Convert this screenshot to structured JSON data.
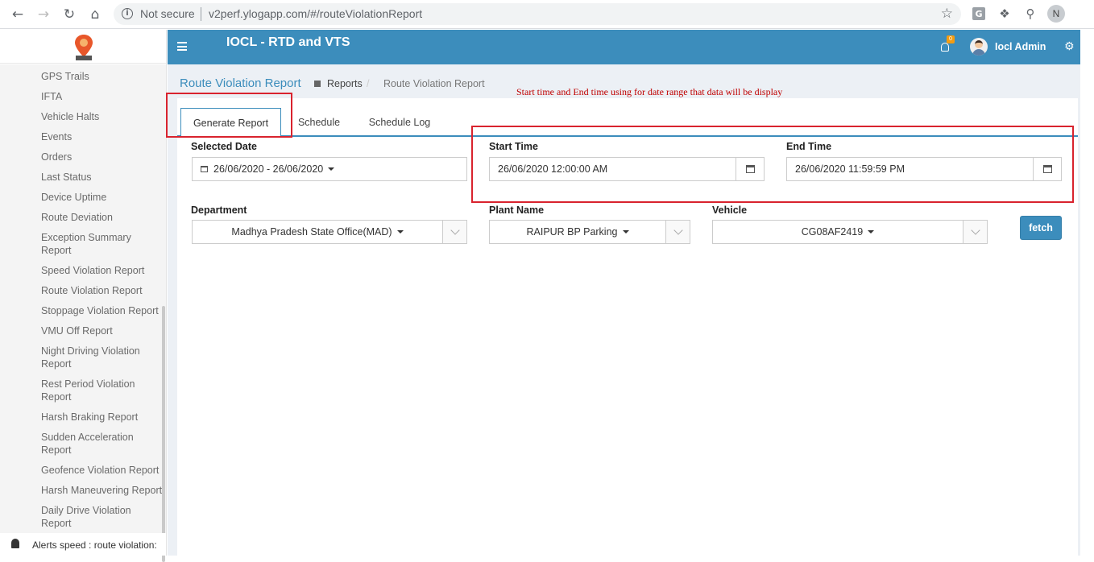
{
  "browser": {
    "security_label": "Not secure",
    "url": "v2perf.ylogapp.com/#/routeViolationReport",
    "profile_initial": "N",
    "extension_g": "G"
  },
  "sidebar": {
    "items": [
      {
        "label": "GPS Trails"
      },
      {
        "label": "IFTA"
      },
      {
        "label": "Vehicle Halts"
      },
      {
        "label": "Events"
      },
      {
        "label": "Orders"
      },
      {
        "label": "Last Status"
      },
      {
        "label": "Device Uptime"
      },
      {
        "label": "Route Deviation"
      },
      {
        "label": "Exception Summary Report"
      },
      {
        "label": "Speed Violation Report"
      },
      {
        "label": "Route Violation Report"
      },
      {
        "label": "Stoppage Violation Report"
      },
      {
        "label": "VMU Off Report"
      },
      {
        "label": "Night Driving Violation Report"
      },
      {
        "label": "Rest Period Violation Report"
      },
      {
        "label": "Harsh Braking Report"
      },
      {
        "label": "Sudden Acceleration Report"
      },
      {
        "label": "Geofence Violation Report"
      },
      {
        "label": "Harsh Maneuvering Report"
      },
      {
        "label": "Daily Drive Violation Report"
      }
    ],
    "bottom_note": "Alerts speed : route violation:"
  },
  "header": {
    "app_title": "IOCL - RTD and VTS",
    "notification_count": "0",
    "user_name": "Iocl Admin"
  },
  "page": {
    "title": "Route Violation Report",
    "breadcrumb_parent": "Reports",
    "breadcrumb_separator": "/",
    "breadcrumb_current": "Route Violation Report",
    "annotation": "Start time and End time using for date range that data will be display"
  },
  "tabs": [
    {
      "label": "Generate Report",
      "active": true
    },
    {
      "label": "Schedule",
      "active": false
    },
    {
      "label": "Schedule Log",
      "active": false
    }
  ],
  "form": {
    "selected_date_label": "Selected Date",
    "selected_date_value": "26/06/2020 - 26/06/2020",
    "start_time_label": "Start Time",
    "start_time_value": "26/06/2020 12:00:00 AM",
    "end_time_label": "End Time",
    "end_time_value": "26/06/2020 11:59:59 PM",
    "department_label": "Department",
    "department_value": "Madhya Pradesh State Office(MAD)",
    "plant_label": "Plant Name",
    "plant_value": "RAIPUR BP Parking",
    "vehicle_label": "Vehicle",
    "vehicle_value": "CG08AF2419",
    "fetch_label": "fetch"
  },
  "colors": {
    "header_blue": "#3c8dbc",
    "annotation_red": "#d9232e",
    "content_bg": "#ecf0f5"
  }
}
